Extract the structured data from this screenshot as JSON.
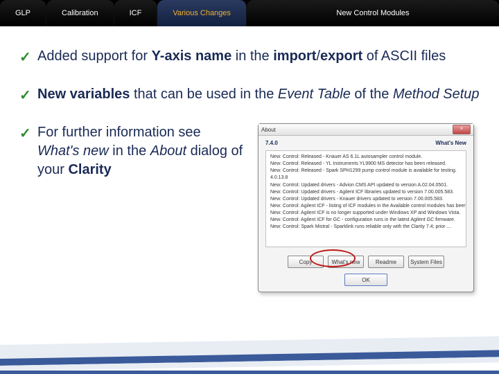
{
  "tabs": [
    {
      "label": "GLP",
      "active": false
    },
    {
      "label": "Calibration",
      "active": false
    },
    {
      "label": "ICF",
      "active": false
    },
    {
      "label": "Various Changes",
      "active": true
    },
    {
      "label": "New Control Modules",
      "active": false
    }
  ],
  "bullets": {
    "b1": {
      "pre": "Added support for ",
      "bold1": "Y-axis name",
      "mid": " in the ",
      "bold2": "import",
      "slash": "/",
      "bold3": "export",
      "post": " of ASCII files"
    },
    "b2": {
      "bold1": "New variables",
      "mid": " that can be used in the ",
      "ital1": "Event Table",
      "mid2": " of the ",
      "ital2": "Method Setup"
    },
    "b3": {
      "pre": "For further information see ",
      "ital1": "What's new",
      "mid": " in the ",
      "ital2": "About",
      "mid2": " dialog of your ",
      "bold1": "Clarity"
    }
  },
  "about": {
    "title": "About",
    "close": "×",
    "version": "7.4.0",
    "whatsnew_header": "What's New",
    "lines": [
      "New: Control: Released - Knauer AS 6.1L autosampler control module.",
      "New: Control: Released - YL Instruments YL9900 MS detector has been released.",
      "New: Control: Released - Spark SPH1299 pump control module is available for testing.",
      "4.0.13.8",
      "New: Control: Updated drivers - Advion CMS API updated to version A.02.04.0501.",
      "New: Control: Updated drivers - Agilent ICF libraries updated to version 7.00.005.583.",
      "New: Control: Updated drivers - Knauer drivers updated to version 7.00.005.583.",
      "New: Control: Agilent ICF - listing of ICF modules in the Available control modules has been improved.",
      "New: Control: Agilent ICF is no longer supported under Windows XP and Windows Vista.",
      "New: Control: Agilent ICF for GC - configuration runs in the latest Agilent GC firmware.",
      "New: Control: Spark Mistral - Sparklink runs reliable only with the Clarity 7.4; prior ..."
    ],
    "buttons": {
      "copy": "Copy",
      "whatsnew": "What's new",
      "readme": "Readme",
      "system": "System Files",
      "ok": "OK"
    }
  }
}
